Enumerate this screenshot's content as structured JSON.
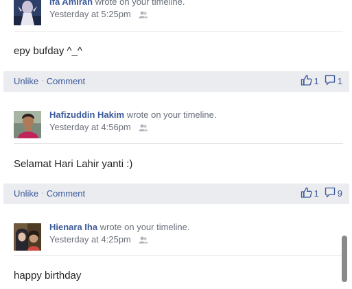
{
  "posts": [
    {
      "author": "Ifa Amirah",
      "action": "wrote on your timeline.",
      "time": "Yesterday at 5:25pm",
      "audience_icon": "friends-icon",
      "text": "epy bufday ^_^",
      "actions": {
        "like": "Unlike",
        "comment": "Comment"
      },
      "likes": "1",
      "comments": "1"
    },
    {
      "author": "Hafizuddin Hakim",
      "action": "wrote on your timeline.",
      "time": "Yesterday at 4:56pm",
      "audience_icon": "friends-icon",
      "text": "Selamat Hari Lahir yanti :)",
      "actions": {
        "like": "Unlike",
        "comment": "Comment"
      },
      "likes": "1",
      "comments": "9"
    },
    {
      "author": "Hienara Iha",
      "action": "wrote on your timeline.",
      "time": "Yesterday at 4:25pm",
      "audience_icon": "friends-icon",
      "text": "happy birthday"
    }
  ],
  "colors": {
    "link": "#3b5998",
    "action_bar": "#ebecf0",
    "meta": "#6b7079"
  }
}
